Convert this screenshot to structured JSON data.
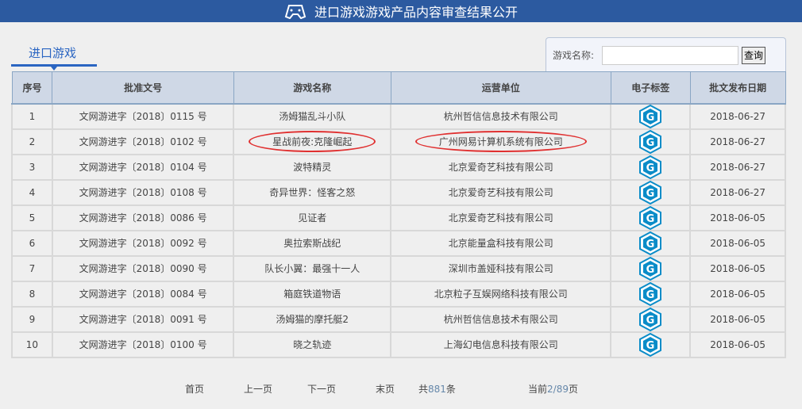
{
  "header": {
    "title": "进口游戏游戏产品内容审查结果公开",
    "icon": "gamepad-icon"
  },
  "tab": {
    "label": "进口游戏"
  },
  "search": {
    "label": "游戏名称:",
    "value": "",
    "button": "查询"
  },
  "table": {
    "columns": [
      "序号",
      "批准文号",
      "游戏名称",
      "运营单位",
      "电子标签",
      "批文发布日期"
    ],
    "rows": [
      {
        "no": "1",
        "approval": "文网游进字〔2018〕0115 号",
        "game": "汤姆猫乱斗小队",
        "operator": "杭州哲信信息技术有限公司",
        "date": "2018-06-27"
      },
      {
        "no": "2",
        "approval": "文网游进字〔2018〕0102 号",
        "game": "星战前夜:克隆崛起",
        "operator": "广州网易计算机系统有限公司",
        "date": "2018-06-27",
        "highlighted": true
      },
      {
        "no": "3",
        "approval": "文网游进字〔2018〕0104 号",
        "game": "波特精灵",
        "operator": "北京爱奇艺科技有限公司",
        "date": "2018-06-27"
      },
      {
        "no": "4",
        "approval": "文网游进字〔2018〕0108 号",
        "game": "奇异世界：怪客之怒",
        "operator": "北京爱奇艺科技有限公司",
        "date": "2018-06-27"
      },
      {
        "no": "5",
        "approval": "文网游进字〔2018〕0086 号",
        "game": "见证者",
        "operator": "北京爱奇艺科技有限公司",
        "date": "2018-06-05"
      },
      {
        "no": "6",
        "approval": "文网游进字〔2018〕0092 号",
        "game": "奥拉索斯战纪",
        "operator": "北京能量盒科技有限公司",
        "date": "2018-06-05"
      },
      {
        "no": "7",
        "approval": "文网游进字〔2018〕0090 号",
        "game": "队长小翼：最强十一人",
        "operator": "深圳市盖娅科技有限公司",
        "date": "2018-06-05"
      },
      {
        "no": "8",
        "approval": "文网游进字〔2018〕0084 号",
        "game": "箱庭铁道物语",
        "operator": "北京粒子互娱网络科技有限公司",
        "date": "2018-06-05"
      },
      {
        "no": "9",
        "approval": "文网游进字〔2018〕0091 号",
        "game": "汤姆猫的摩托艇2",
        "operator": "杭州哲信信息技术有限公司",
        "date": "2018-06-05"
      },
      {
        "no": "10",
        "approval": "文网游进字〔2018〕0100 号",
        "game": "晓之轨迹",
        "operator": "上海幻电信息科技有限公司",
        "date": "2018-06-05"
      }
    ]
  },
  "pager": {
    "first": "首页",
    "prev": "上一页",
    "next": "下一页",
    "last": "末页",
    "total_prefix": "共",
    "total": "881",
    "total_suffix": "条",
    "current_prefix": "当前",
    "current": "2/89",
    "current_suffix": "页"
  },
  "colors": {
    "header": "#2c5aa0",
    "accent": "#2a65c2",
    "badge": "#0a8cc8",
    "highlight": "#e03030"
  }
}
